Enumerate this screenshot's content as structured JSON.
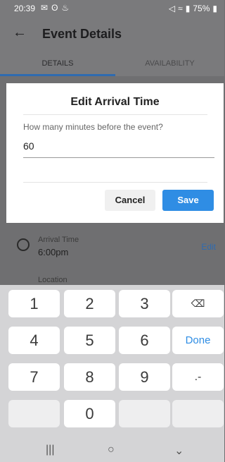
{
  "status_bar": {
    "time": "20:39",
    "battery": "75%",
    "icons": [
      "mail-icon",
      "bluetooth-icon",
      "fire-icon",
      "mute-icon",
      "wifi-icon",
      "signal-icon",
      "battery-icon"
    ]
  },
  "app_bar": {
    "title": "Event Details",
    "back_icon": "back-arrow-icon"
  },
  "tabs": [
    {
      "label": "DETAILS",
      "active": true
    },
    {
      "label": "AVAILABILITY",
      "active": false
    }
  ],
  "dialog": {
    "title": "Edit Arrival Time",
    "question": "How many minutes before the event?",
    "value": "60",
    "cancel_label": "Cancel",
    "save_label": "Save"
  },
  "details": {
    "arrival_label": "Arrival Time",
    "arrival_value": "6:00pm",
    "edit_label": "Edit",
    "location_label": "Location"
  },
  "keyboard": {
    "keys": [
      "1",
      "2",
      "3",
      "4",
      "5",
      "6",
      "Done",
      "7",
      "8",
      "9",
      ".-",
      "0"
    ],
    "done_color": "#2f8de4"
  },
  "colors": {
    "accent": "#2f8de4",
    "tab_indicator": "#2f6bb0"
  }
}
